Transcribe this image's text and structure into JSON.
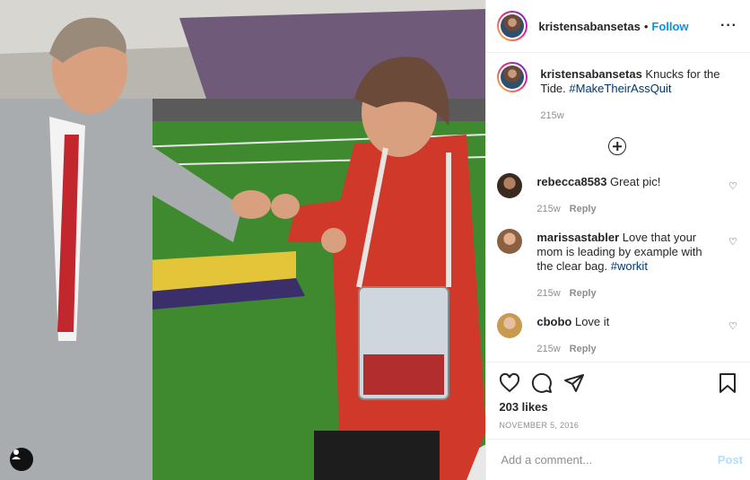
{
  "header": {
    "username": "kristensabansetas",
    "separator": "•",
    "follow_label": "Follow",
    "more_label": "···"
  },
  "caption": {
    "username": "kristensabansetas",
    "text": " Knucks for the Tide. ",
    "hashtag": "#MakeTheirAssQuit",
    "time": "215w"
  },
  "comments": [
    {
      "username": "rebecca8583",
      "text": " Great pic!",
      "hashtag": "",
      "time": "215w",
      "reply": "Reply"
    },
    {
      "username": "marissastabler",
      "text": " Love that your mom is leading by example with the clear bag. ",
      "hashtag": "#workit",
      "time": "215w",
      "reply": "Reply"
    },
    {
      "username": "cbobo",
      "text": " Love it",
      "hashtag": "",
      "time": "215w",
      "reply": "Reply"
    }
  ],
  "likes": "203 likes",
  "date": "NOVEMBER 5, 2016",
  "add_comment": {
    "placeholder": "Add a comment...",
    "post_label": "Post"
  },
  "colors": {
    "accent": "#0095f6",
    "post_disabled": "#b2dffc",
    "hashtag": "#00376b"
  },
  "icons": [
    "heart-icon",
    "comment-icon",
    "share-icon",
    "bookmark-icon",
    "add-comments-icon",
    "user-tag-icon"
  ]
}
